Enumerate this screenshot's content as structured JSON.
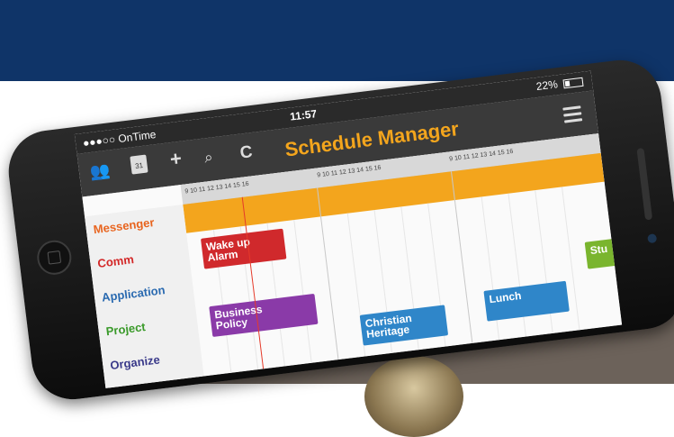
{
  "status_bar": {
    "carrier": "●●●○○ OnTime",
    "time": "11:57",
    "battery": "22%"
  },
  "toolbar": {
    "calendar_day": "31",
    "add_glyph": "+",
    "search_glyph": "⌕",
    "refresh_glyph": "C",
    "people_glyph": "👥"
  },
  "app": {
    "title": "Schedule Manager"
  },
  "timeline": {
    "hour_groups": [
      "9  10  11  12  13  14  15  16",
      "9  10  11  12  13  14  15  16",
      "9  10  11  12  13  14  15  16"
    ],
    "rows": [
      {
        "label": "Messenger",
        "color": "#e8641e"
      },
      {
        "label": "Comm",
        "color": "#d32727"
      },
      {
        "label": "Application",
        "color": "#2a6ab0"
      },
      {
        "label": "Project",
        "color": "#3a9a2a"
      },
      {
        "label": "Organize",
        "color": "#3a3a8a"
      }
    ],
    "events": [
      {
        "line1": "Wake up",
        "line2": "Alarm",
        "color": "#d0292c"
      },
      {
        "line1": "Business",
        "line2": "Policy",
        "color": "#8a3aa8"
      },
      {
        "line1": "Christian",
        "line2": "Heritage",
        "color": "#2f86c9"
      },
      {
        "line1": "Lunch",
        "line2": "",
        "color": "#2f86c9"
      },
      {
        "line1": "Stu",
        "line2": "",
        "color": "#7ab52e"
      }
    ]
  },
  "colors": {
    "header_bg": "#3a3a3a",
    "title_accent": "#f3a51d",
    "band_orange": "#f3a51d",
    "now_line": "#e53a2a",
    "page_top_navy": "#0f3468"
  }
}
